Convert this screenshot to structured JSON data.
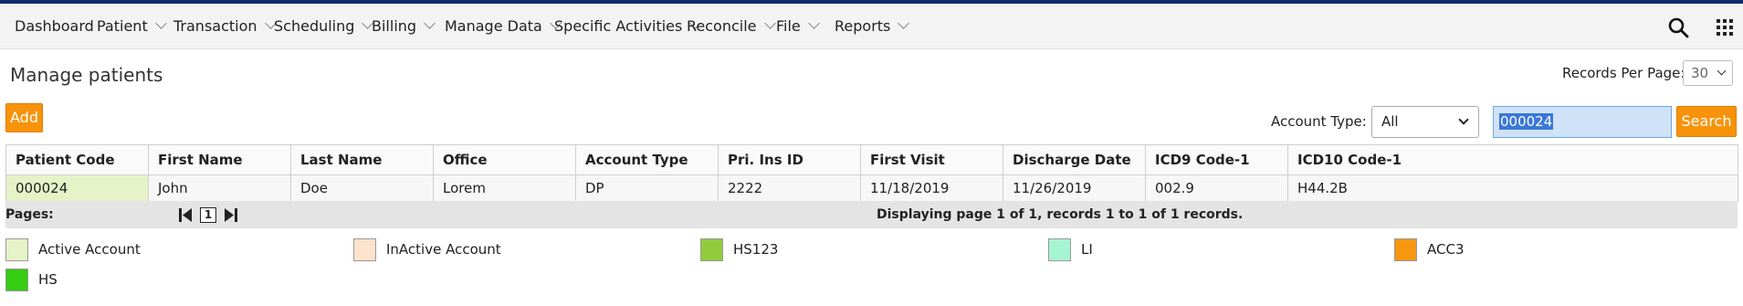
{
  "nav": {
    "items": [
      {
        "label": "Dashboard",
        "has_menu": false
      },
      {
        "label": "Patient",
        "has_menu": true
      },
      {
        "label": "Transaction",
        "has_menu": true
      },
      {
        "label": "Scheduling",
        "has_menu": true
      },
      {
        "label": "Billing",
        "has_menu": true
      },
      {
        "label": "Manage Data",
        "has_menu": true
      },
      {
        "label": "Specific Activities",
        "has_menu": true
      },
      {
        "label": "Reconcile",
        "has_menu": true
      },
      {
        "label": "File",
        "has_menu": true
      },
      {
        "label": "Reports",
        "has_menu": true
      }
    ],
    "icons": [
      "search-icon",
      "grid-menu-icon"
    ]
  },
  "page": {
    "title": "Manage patients",
    "records_per_page_label": "Records Per Page:",
    "records_per_page_value": "30",
    "add_label": "Add",
    "account_type_label": "Account Type:",
    "account_type_value": "All",
    "search_value": "000024",
    "search_label": "Search"
  },
  "table": {
    "headers": [
      "Patient Code",
      "First Name",
      "Last Name",
      "Office",
      "Account Type",
      "Pri. Ins ID",
      "First Visit",
      "Discharge Date",
      "ICD9 Code-1",
      "ICD10 Code-1"
    ],
    "rows": [
      [
        "000024",
        "John",
        "Doe",
        "Lorem",
        "DP",
        "2222",
        "11/18/2019",
        "11/26/2019",
        "002.9",
        "H44.2B"
      ]
    ]
  },
  "pager": {
    "label": "Pages:",
    "current_page": "1",
    "display_text": "Displaying page 1 of 1, records 1 to 1 of 1 records."
  },
  "legend": [
    {
      "label": "Active Account",
      "color": "#e6f2c8"
    },
    {
      "label": "InActive Account",
      "color": "#fde3cc"
    },
    {
      "label": "HS123",
      "color": "#92cc3c"
    },
    {
      "label": "LI",
      "color": "#a6f5d2"
    },
    {
      "label": "ACC3",
      "color": "#f7960f"
    },
    {
      "label": "HS",
      "color": "#35cc12"
    }
  ],
  "colors": {
    "accent": "#f7930a",
    "top_bar": "#0d2a6b",
    "search_field": "#cfe2f8",
    "selection": "#3a78d8"
  }
}
